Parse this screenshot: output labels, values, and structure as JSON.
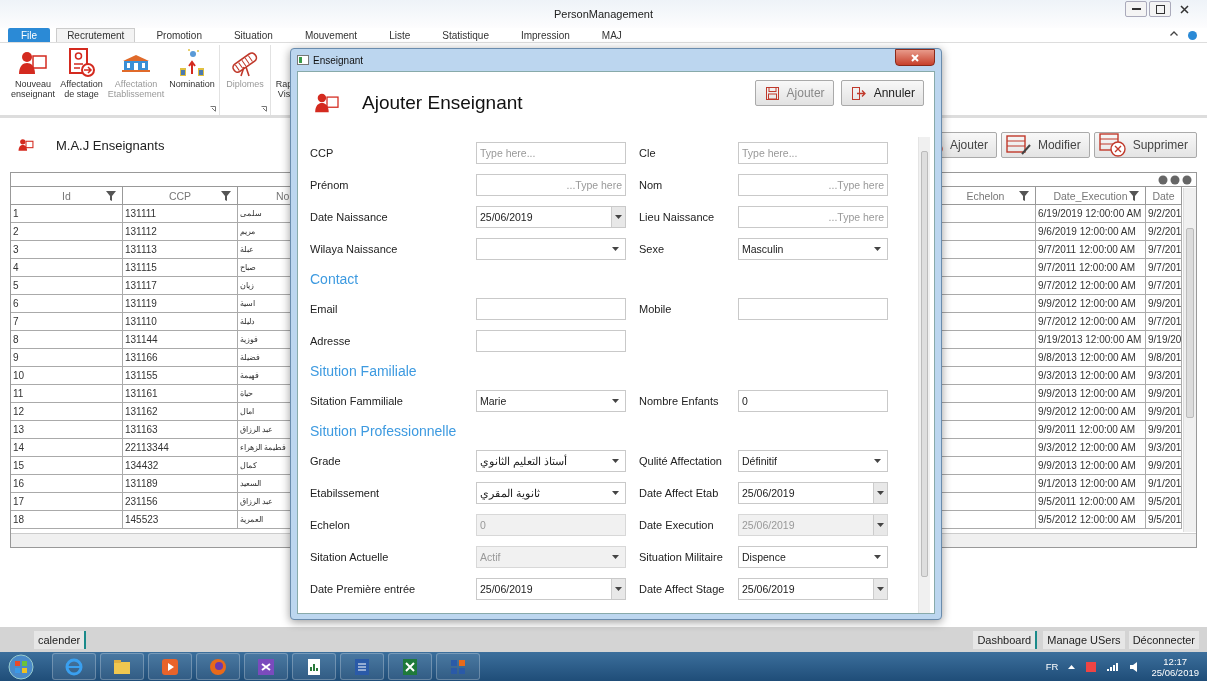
{
  "window": {
    "title": "PersonManagement"
  },
  "ribbon": {
    "tabs": [
      {
        "label": "File",
        "kind": "file",
        "selected": false
      },
      {
        "label": "Recrutement",
        "kind": "tab",
        "selected": true
      },
      {
        "label": "Promotion",
        "kind": "tab",
        "selected": false
      },
      {
        "label": "Situation",
        "kind": "tab",
        "selected": false
      },
      {
        "label": "Mouvement",
        "kind": "tab",
        "selected": false
      },
      {
        "label": "Liste",
        "kind": "tab",
        "selected": false
      },
      {
        "label": "Statistique",
        "kind": "tab",
        "selected": false
      },
      {
        "label": "Impression",
        "kind": "tab",
        "selected": false
      },
      {
        "label": "MAJ",
        "kind": "tab",
        "selected": false
      }
    ],
    "groups": [
      {
        "buttons": [
          {
            "label": "Nouveau enseignant",
            "kind": "person",
            "disabled": false
          },
          {
            "label": "Affectation de stage",
            "kind": "form",
            "disabled": false
          },
          {
            "label": "Affectation Etablissement",
            "kind": "building",
            "disabled": true
          },
          {
            "label": "Nomination",
            "kind": "promote",
            "disabled": false
          }
        ]
      },
      {
        "buttons": [
          {
            "label": "Diplomes",
            "kind": "diploma",
            "disabled": true
          }
        ]
      },
      {
        "buttons": [
          {
            "label": "Rap Vis",
            "kind": "none"
          }
        ]
      }
    ]
  },
  "panel": {
    "title": "M.A.J Enseignants",
    "buttons": [
      {
        "label": "Ajouter",
        "kind": "add"
      },
      {
        "label": "Modifier",
        "kind": "edit"
      },
      {
        "label": "Supprimer",
        "kind": "delete"
      }
    ]
  },
  "table": {
    "columns": [
      "Id",
      "CCP",
      "No",
      "Echelon",
      "Date_Execution",
      "Date"
    ],
    "rows": [
      [
        "1",
        "131111",
        "سلمى",
        "",
        "6/19/2019 12:00:00 AM",
        "9/2/201"
      ],
      [
        "2",
        "131112",
        "مريم",
        "",
        "9/6/2019 12:00:00 AM",
        "9/2/201"
      ],
      [
        "3",
        "131113",
        "عبلة",
        "",
        "9/7/2011 12:00:00 AM",
        "9/7/201"
      ],
      [
        "4",
        "131115",
        "صباح",
        "",
        "9/7/2011 12:00:00 AM",
        "9/7/201"
      ],
      [
        "5",
        "131117",
        "زيان",
        "",
        "9/7/2012 12:00:00 AM",
        "9/7/201"
      ],
      [
        "6",
        "131119",
        "اسية",
        "",
        "9/9/2012 12:00:00 AM",
        "9/9/201"
      ],
      [
        "7",
        "131110",
        "دليلة",
        "",
        "9/7/2012 12:00:00 AM",
        "9/7/201"
      ],
      [
        "8",
        "131144",
        "فوزية",
        "",
        "9/19/2013 12:00:00 AM",
        "9/19/20"
      ],
      [
        "9",
        "131166",
        "فضيلة",
        "",
        "9/8/2013 12:00:00 AM",
        "9/8/201"
      ],
      [
        "10",
        "131155",
        "فهيمة",
        "",
        "9/3/2013 12:00:00 AM",
        "9/3/201"
      ],
      [
        "11",
        "131161",
        "حياة",
        "",
        "9/9/2013 12:00:00 AM",
        "9/9/201"
      ],
      [
        "12",
        "131162",
        "امال",
        "",
        "9/9/2012 12:00:00 AM",
        "9/9/201"
      ],
      [
        "13",
        "131163",
        "عبد الرزاق",
        "",
        "9/9/2011 12:00:00 AM",
        "9/9/201"
      ],
      [
        "14",
        "22113344",
        "فطيمة الزهراء",
        "",
        "9/3/2012 12:00:00 AM",
        "9/3/201"
      ],
      [
        "15",
        "134432",
        "كمال",
        "",
        "9/9/2013 12:00:00 AM",
        "9/9/201"
      ],
      [
        "16",
        "131189",
        "السعيد",
        "",
        "9/1/2013 12:00:00 AM",
        "9/1/201"
      ],
      [
        "17",
        "231156",
        "عبد الرزاق",
        "",
        "9/5/2011 12:00:00 AM",
        "9/5/201"
      ],
      [
        "18",
        "145523",
        "العمرية",
        "",
        "9/5/2012 12:00:00 AM",
        "9/5/201"
      ]
    ]
  },
  "dialog": {
    "title": "Enseignant",
    "heading": "Ajouter Enseignant",
    "buttons": [
      {
        "label": "Ajouter",
        "kind": "save",
        "disabled": true
      },
      {
        "label": "Annuler",
        "kind": "exit",
        "disabled": false
      }
    ],
    "rows": [
      {
        "kind": "pair",
        "fields": [
          {
            "label": "CCP",
            "kind": "text",
            "placeholder": "Type here...",
            "rtl": false,
            "disabled": false
          },
          {
            "label": "Cle",
            "kind": "text",
            "placeholder": "Type here...",
            "rtl": false,
            "disabled": false
          }
        ]
      },
      {
        "kind": "pair",
        "fields": [
          {
            "label": "Prénom",
            "kind": "text",
            "placeholder": "...Type here",
            "rtl": true,
            "disabled": false
          },
          {
            "label": "Nom",
            "kind": "text",
            "placeholder": "...Type here",
            "rtl": true,
            "disabled": false
          }
        ]
      },
      {
        "kind": "pair",
        "fields": [
          {
            "label": "Date Naissance",
            "kind": "date",
            "value": "25/06/2019",
            "disabled": false
          },
          {
            "label": "Lieu Naissance",
            "kind": "text",
            "placeholder": "...Type here",
            "rtl": true,
            "disabled": false
          }
        ]
      },
      {
        "kind": "pair",
        "fields": [
          {
            "label": "Wilaya Naissance",
            "kind": "combo",
            "disabled": false
          },
          {
            "label": "Sexe",
            "kind": "combo",
            "value": "Masculin",
            "disabled": false
          }
        ]
      },
      {
        "kind": "section",
        "label": "Contact"
      },
      {
        "kind": "pair",
        "fields": [
          {
            "label": "Email",
            "kind": "text",
            "disabled": false
          },
          {
            "label": "Mobile",
            "kind": "text",
            "disabled": false
          }
        ]
      },
      {
        "kind": "pair",
        "fields": [
          {
            "label": "Adresse",
            "kind": "text",
            "disabled": false
          }
        ]
      },
      {
        "kind": "section",
        "label": "Sitution Familiale"
      },
      {
        "kind": "pair",
        "fields": [
          {
            "label": "Sitation Fammiliale",
            "kind": "combo",
            "value": "Marie",
            "disabled": false
          },
          {
            "label": "Nombre Enfants",
            "kind": "text",
            "value": "0",
            "rtl": false,
            "disabled": false
          }
        ]
      },
      {
        "kind": "section",
        "label": "Sitution Professionnelle"
      },
      {
        "kind": "pair",
        "fields": [
          {
            "label": "Grade",
            "kind": "combo",
            "value": "أستاذ التعليم الثانوي",
            "disabled": false
          },
          {
            "label": "Qulité Affectation",
            "kind": "combo",
            "value": "Définitif",
            "disabled": false
          }
        ]
      },
      {
        "kind": "pair",
        "fields": [
          {
            "label": "Etabilssement",
            "kind": "combo",
            "value": "ثانوية المقري",
            "disabled": false
          },
          {
            "label": "Date Affect Etab",
            "kind": "date",
            "value": "25/06/2019",
            "disabled": false
          }
        ]
      },
      {
        "kind": "pair",
        "fields": [
          {
            "label": "Echelon",
            "kind": "text",
            "value": "0",
            "rtl": false,
            "disabled": true
          },
          {
            "label": "Date Execution",
            "kind": "date",
            "value": "25/06/2019",
            "disabled": true
          }
        ]
      },
      {
        "kind": "pair",
        "fields": [
          {
            "label": "Sitation Actuelle",
            "kind": "combo",
            "value": "Actif",
            "disabled": true
          },
          {
            "label": "Situation Militaire",
            "kind": "combo",
            "value": "Dispence",
            "disabled": false
          }
        ]
      },
      {
        "kind": "pair",
        "fields": [
          {
            "label": "Date Première entrée",
            "kind": "date",
            "value": "25/06/2019",
            "disabled": false
          },
          {
            "label": "Date Affect Stage",
            "kind": "date",
            "value": "25/06/2019",
            "disabled": false
          }
        ]
      }
    ]
  },
  "status_bar": {
    "left": [
      "calender"
    ],
    "right": [
      "Dashboard",
      "Manage USers",
      "Déconnecter"
    ]
  },
  "taskbar": {
    "language": "FR",
    "time": "12:17",
    "date": "25/06/2019"
  }
}
